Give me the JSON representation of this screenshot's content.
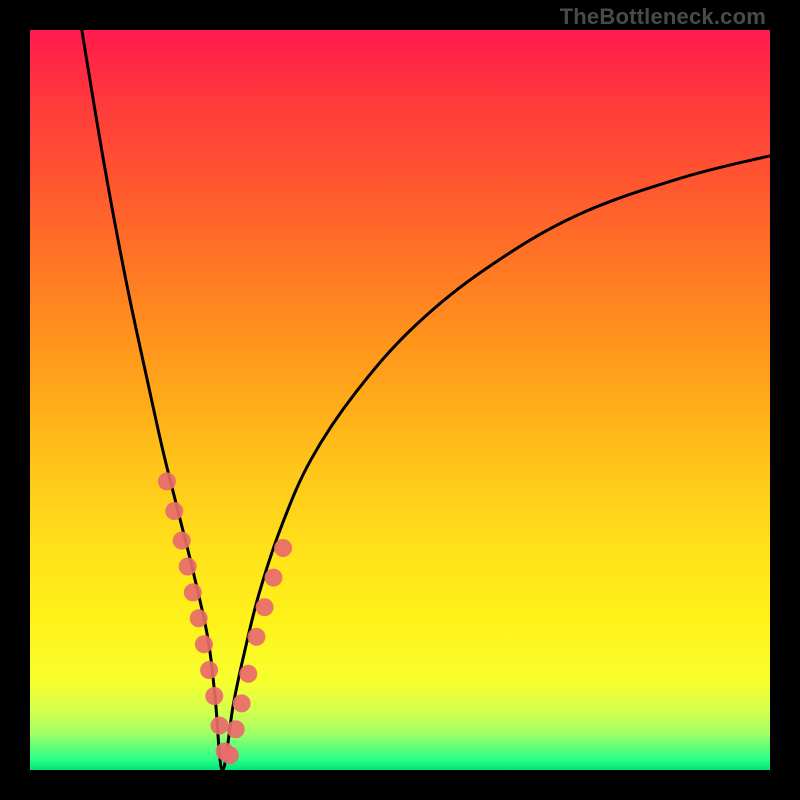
{
  "watermark": "TheBottleneck.com",
  "colors": {
    "frame": "#000000",
    "curve": "#000000",
    "marker_fill": "#e86b6b",
    "marker_stroke": "#c94f4f",
    "gradient_top": "#ff1a4d",
    "gradient_bottom": "#00e676"
  },
  "chart_data": {
    "type": "line",
    "title": "",
    "xlabel": "",
    "ylabel": "",
    "xlim": [
      0,
      100
    ],
    "ylim": [
      0,
      100
    ],
    "notes": "V-shaped bottleneck curve over a red→green vertical gradient. Minimum (optimum) near x≈26. Left branch rises steeply to the top-left corner; right branch rises more gradually toward the top-right. Circular markers cluster in the lower portion of both branches, near the valley.",
    "series": [
      {
        "name": "curve-left",
        "x": [
          7,
          10,
          13,
          16,
          18,
          20,
          22,
          24,
          25,
          26
        ],
        "y": [
          100,
          82,
          66,
          52,
          43,
          35,
          27,
          18,
          10,
          0
        ]
      },
      {
        "name": "curve-right",
        "x": [
          26,
          27.5,
          29,
          31,
          34,
          38,
          44,
          52,
          62,
          74,
          88,
          100
        ],
        "y": [
          0,
          9,
          16,
          24,
          33,
          42,
          51,
          60,
          68,
          75,
          80,
          83
        ]
      }
    ],
    "markers": {
      "name": "data-points",
      "x": [
        18.5,
        19.5,
        20.5,
        21.3,
        22.0,
        22.8,
        23.5,
        24.2,
        24.9,
        25.6,
        26.3,
        27.0,
        27.8,
        28.6,
        29.5,
        30.6,
        31.7,
        32.9,
        34.2
      ],
      "y": [
        39,
        35,
        31,
        27.5,
        24,
        20.5,
        17,
        13.5,
        10,
        6,
        2.5,
        2,
        5.5,
        9,
        13,
        18,
        22,
        26,
        30
      ],
      "r": 9
    }
  }
}
